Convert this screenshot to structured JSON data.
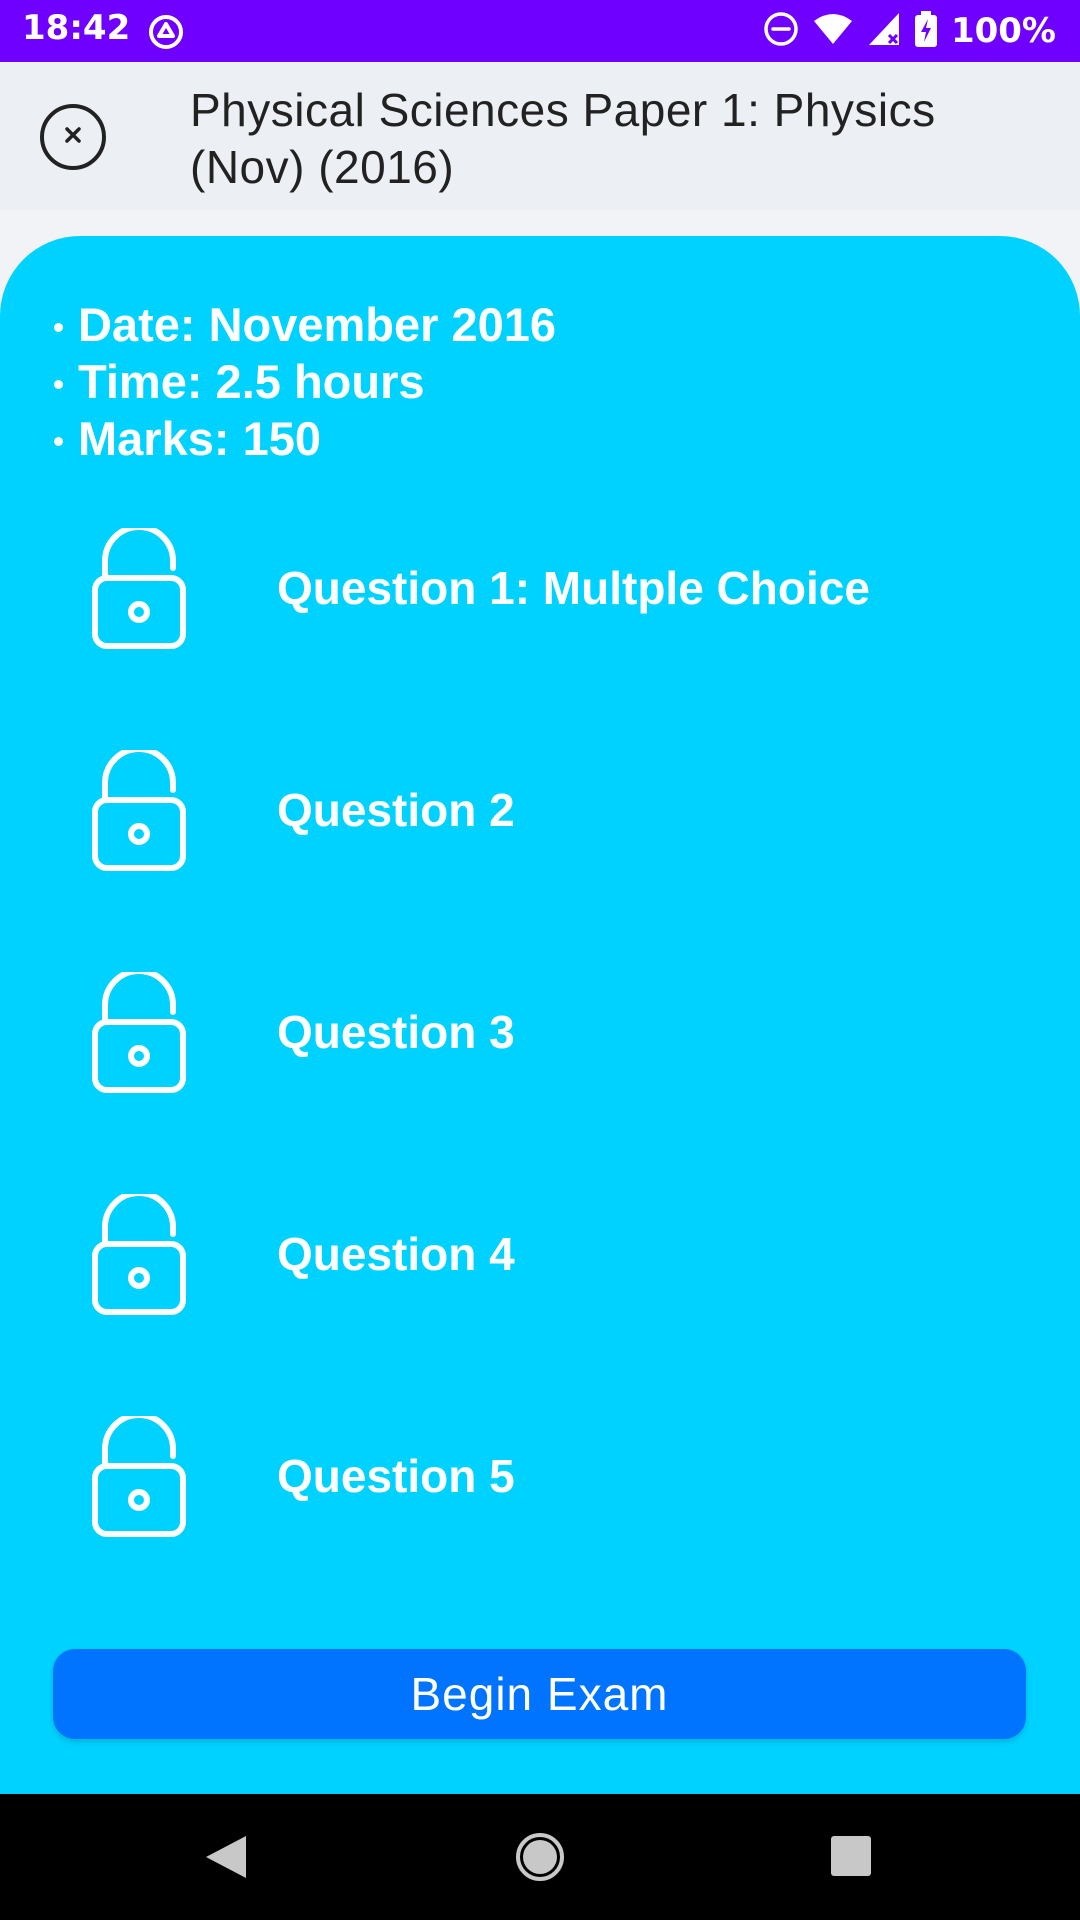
{
  "status_bar": {
    "time": "18:42",
    "battery_percent": "100%"
  },
  "header": {
    "title": "Physical Sciences Paper 1: Physics (Nov) (2016)"
  },
  "info": {
    "items": [
      "Date: November 2016",
      "Time: 2.5 hours",
      "Marks: 150"
    ]
  },
  "questions": [
    "Question 1: Multple Choice",
    "Question 2",
    "Question 3",
    "Question 4",
    "Question 5"
  ],
  "actions": {
    "begin_label": "Begin Exam"
  },
  "colors": {
    "status_bar": "#6f00ff",
    "card": "#00d2ff",
    "button": "#0073ff"
  },
  "icons": {
    "close": "close-circle-icon",
    "question": "unlocked-padlock-icon"
  }
}
